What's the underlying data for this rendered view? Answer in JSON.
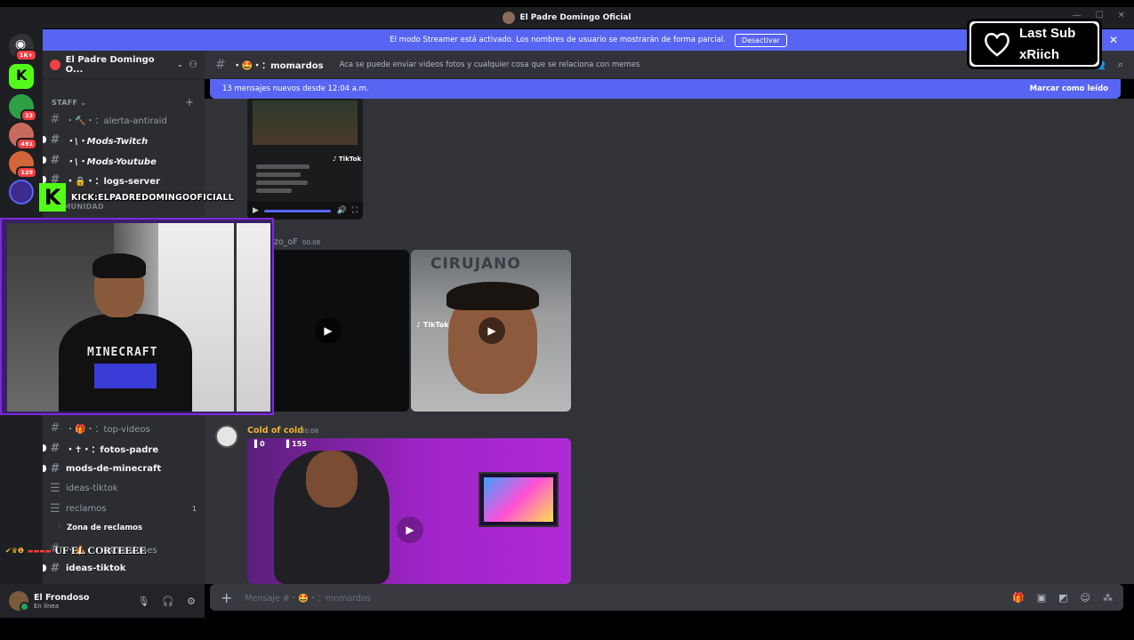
{
  "window": {
    "title": "El Padre Domingo Oficial"
  },
  "streamer_bar": {
    "text": "El modo Streamer está activado. Los nombres de usuario se mostrarán de forma parcial.",
    "button": "Desactivar"
  },
  "guilds": {
    "badges": [
      "1K+",
      "33",
      "491",
      "129"
    ]
  },
  "server": {
    "name": "El Padre Domingo O..."
  },
  "categories": {
    "staff": "STAFF",
    "comunidad": "COMUNIDAD"
  },
  "channels": [
    {
      "name": "・🔨・：alerta-antiraid"
    },
    {
      "name": "・\\・Mods-Twitch"
    },
    {
      "name": "・\\・Mods-Youtube"
    },
    {
      "name": "・🔒・：logs-server"
    },
    {
      "name": "・🎁・：top-videos"
    },
    {
      "name": "・✝・：fotos-padre"
    },
    {
      "name": "mods-de-minecraft"
    },
    {
      "name": "ideas-tiktok"
    },
    {
      "name": "reclamos",
      "count": "1"
    },
    {
      "name": "Zona de reclamos"
    },
    {
      "name": "・🔥・：extensiones"
    },
    {
      "name": "ideas-tiktok"
    }
  ],
  "user": {
    "name": "El Frondoso",
    "status": "En línea"
  },
  "chat_header": {
    "channel": "・🤩・：momardos",
    "topic": "Aca se puede enviar videos fotos y cualquier cosa que se relaciona con memes"
  },
  "new_messages": {
    "text": "13 mensajes nuevos desde 12:04 a.m.",
    "action": "Marcar como leído"
  },
  "messages": [
    {
      "author": "zo_oF",
      "time": "00:08",
      "media_label": "CIRUJANO",
      "tiktok": "TikTok"
    },
    {
      "author": "Cold of cold",
      "time": "00:08",
      "counter_a": "0",
      "counter_b": "155"
    }
  ],
  "first_video": {
    "tiktok": "TikTok"
  },
  "composer": {
    "placeholder": "Mensaje #・🤩・：momardos"
  },
  "overlay": {
    "kick_text": "KICK:ELPADREDOMINGOOFICIALL",
    "last_sub_label": "Last Sub",
    "last_sub_name": "xRiich",
    "chat_text": "UF EL CORTEEEE",
    "cam_shirt": "MINECRAFT"
  },
  "colors": {
    "accent": "#5865f2",
    "kick": "#53fc18",
    "author": "#f0b232"
  }
}
